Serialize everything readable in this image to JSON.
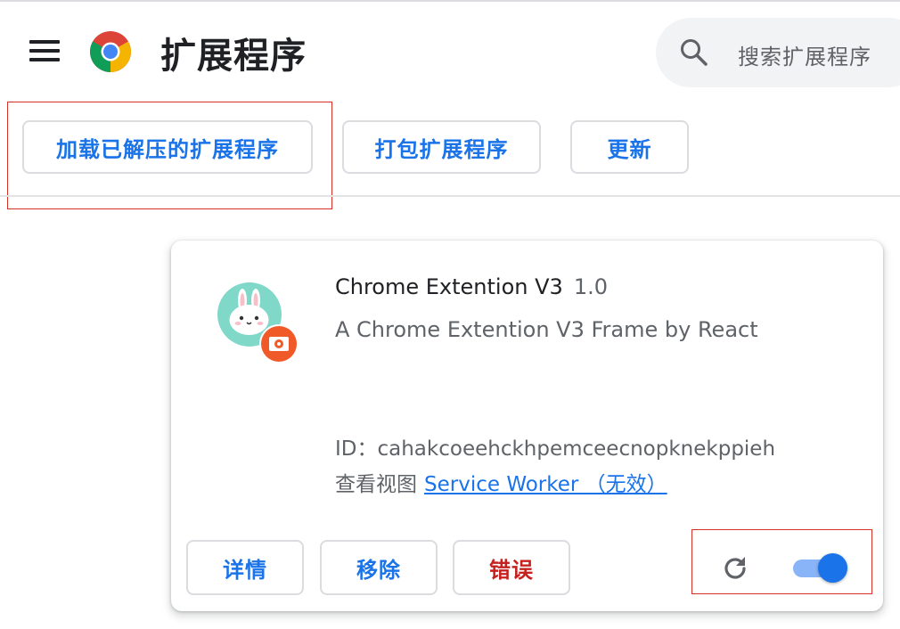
{
  "header": {
    "title": "扩展程序",
    "search_placeholder": "搜索扩展程序"
  },
  "toolbar": {
    "load_unpacked_label": "加载已解压的扩展程序",
    "pack_label": "打包扩展程序",
    "update_label": "更新"
  },
  "extension": {
    "name": "Chrome Extention V3",
    "version": "1.0",
    "description": "A Chrome Extention V3 Frame by React",
    "id_text": "ID：cahakcoeehckhpemceecnopknekppieh",
    "views_label": "查看视图",
    "views_link": "Service Worker （无效）",
    "enabled": true,
    "buttons": {
      "details": "详情",
      "remove": "移除",
      "errors": "错误"
    }
  },
  "colors": {
    "accent": "#1a73e8",
    "error": "#c5221f",
    "highlight_box": "#d93025",
    "toggle_track": "#8ab4f8"
  },
  "icons": [
    "menu-icon",
    "chrome-logo-icon",
    "search-icon",
    "extension-rabbit-icon",
    "reload-icon"
  ]
}
